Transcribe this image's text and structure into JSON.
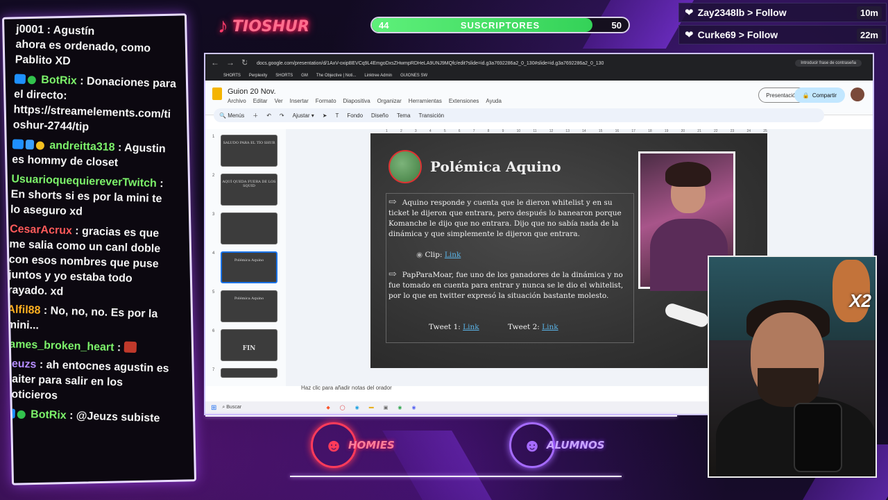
{
  "overlay": {
    "logo_text": "TIOSHUR",
    "subs": {
      "start": "44",
      "label": "SUSCRIPTORES",
      "end": "50",
      "progress": 0.86
    },
    "follows": [
      {
        "name": "Zay2348lb",
        "action": "Follow",
        "time": "10m"
      },
      {
        "name": "Curke69",
        "action": "Follow",
        "time": "22m"
      }
    ],
    "bottom_logos": {
      "left": "HOMIES",
      "right": "ALUMNOS"
    },
    "multiplier": "X2"
  },
  "chat": [
    {
      "user": "",
      "color": "#ffffff",
      "text": "ahora es ordenado, como Pablito XD",
      "pre": "j0001 : Agustín"
    },
    {
      "user": "BotRix",
      "color": "#7cf26a",
      "text": "Donaciones para el directo: https://streamelements.com/tioshur-2744/tip"
    },
    {
      "user": "andreitta318",
      "color": "#7cf26a",
      "text": "Agustin es hommy de closet"
    },
    {
      "user": "UsuarioquequiereverTwitch",
      "color": "#7cf26a",
      "text": "En shorts si es por la mini te lo aseguro xd"
    },
    {
      "user": "CesarAcrux",
      "color": "#ff5a5a",
      "text": "gracias es que me salia como un canl doble con esos nombres que puse juntos y yo estaba todo rayado. xd"
    },
    {
      "user": "Alfil88",
      "color": "#ffb020",
      "text": "No, no, no. Es por la mini..."
    },
    {
      "user": "james_broken_heart",
      "color": "#7cf26a",
      "text": ""
    },
    {
      "user": "Jeuzs",
      "color": "#b48cff",
      "text": "ah entocnes agustin es baiter para salir en los noticieros"
    },
    {
      "user": "BotRix",
      "color": "#7cf26a",
      "text": "@Jeuzs subiste al"
    }
  ],
  "browser": {
    "url": "docs.google.com/presentation/d/1AxV-oxipBEVCq9L4EmgoDxsZHwmpRDHeLA9UNJ9MQfc/edit?slide=id.g3a7692286a2_0_130#slide=id.g3a7692286a2_0_130",
    "bookmarks": [
      "SHORTS",
      "Perplexity",
      "SHORTS",
      "GM",
      "The Objective | Noti...",
      "Linktree Admin",
      "GUIONES SW"
    ],
    "password_hint": "Introducir frase de contraseña",
    "docs_title": "Guion 20 Nov.",
    "menu": [
      "Archivo",
      "Editar",
      "Ver",
      "Insertar",
      "Formato",
      "Diapositiva",
      "Organizar",
      "Herramientas",
      "Extensiones",
      "Ayuda"
    ],
    "present_label": "Presentación",
    "share_label": "Compartir",
    "toolbar": [
      "Menús",
      "Ajustar",
      "Fondo",
      "Diseño",
      "Tema",
      "Transición"
    ],
    "ruler": [
      "1",
      "2",
      "3",
      "4",
      "5",
      "6",
      "7",
      "8",
      "9",
      "10",
      "11",
      "12",
      "13",
      "14",
      "15",
      "16",
      "17",
      "18",
      "19",
      "20",
      "21",
      "22",
      "23",
      "24",
      "25"
    ],
    "thumbs": [
      {
        "num": "1",
        "title": "SALUDO PARA EL TÍO SHUR"
      },
      {
        "num": "2",
        "title": "AQUÍ QUEDA FUERA DE LOS SQUID"
      },
      {
        "num": "3",
        "title": ""
      },
      {
        "num": "4",
        "title": "Polémica Aquino"
      },
      {
        "num": "5",
        "title": "Polémica Aquino"
      },
      {
        "num": "6",
        "title": "FIN"
      },
      {
        "num": "7",
        "title": ""
      }
    ],
    "notes": "Haz clic para añadir notas del orador",
    "search": "Buscar"
  },
  "slide": {
    "title": "Polémica Aquino",
    "p1": "Aquino responde y cuenta que le dieron whitelist y en su ticket le dijeron que entrara, pero después lo banearon porque Komanche le dijo que no entrara. Dijo que no sabía nada de la dinámica y que simplemente le dijeron que entrara.",
    "clip_label": "Clip:",
    "link": "Link",
    "p2": "PapParaMoar, fue uno de los ganadores de la dinámica y no fue tomado en cuenta para entrar y nunca se le dio el whitelist, por lo que en twitter expresó la situación bastante molesto.",
    "tweet1": "Tweet 1:",
    "tweet2": "Tweet 2:"
  }
}
